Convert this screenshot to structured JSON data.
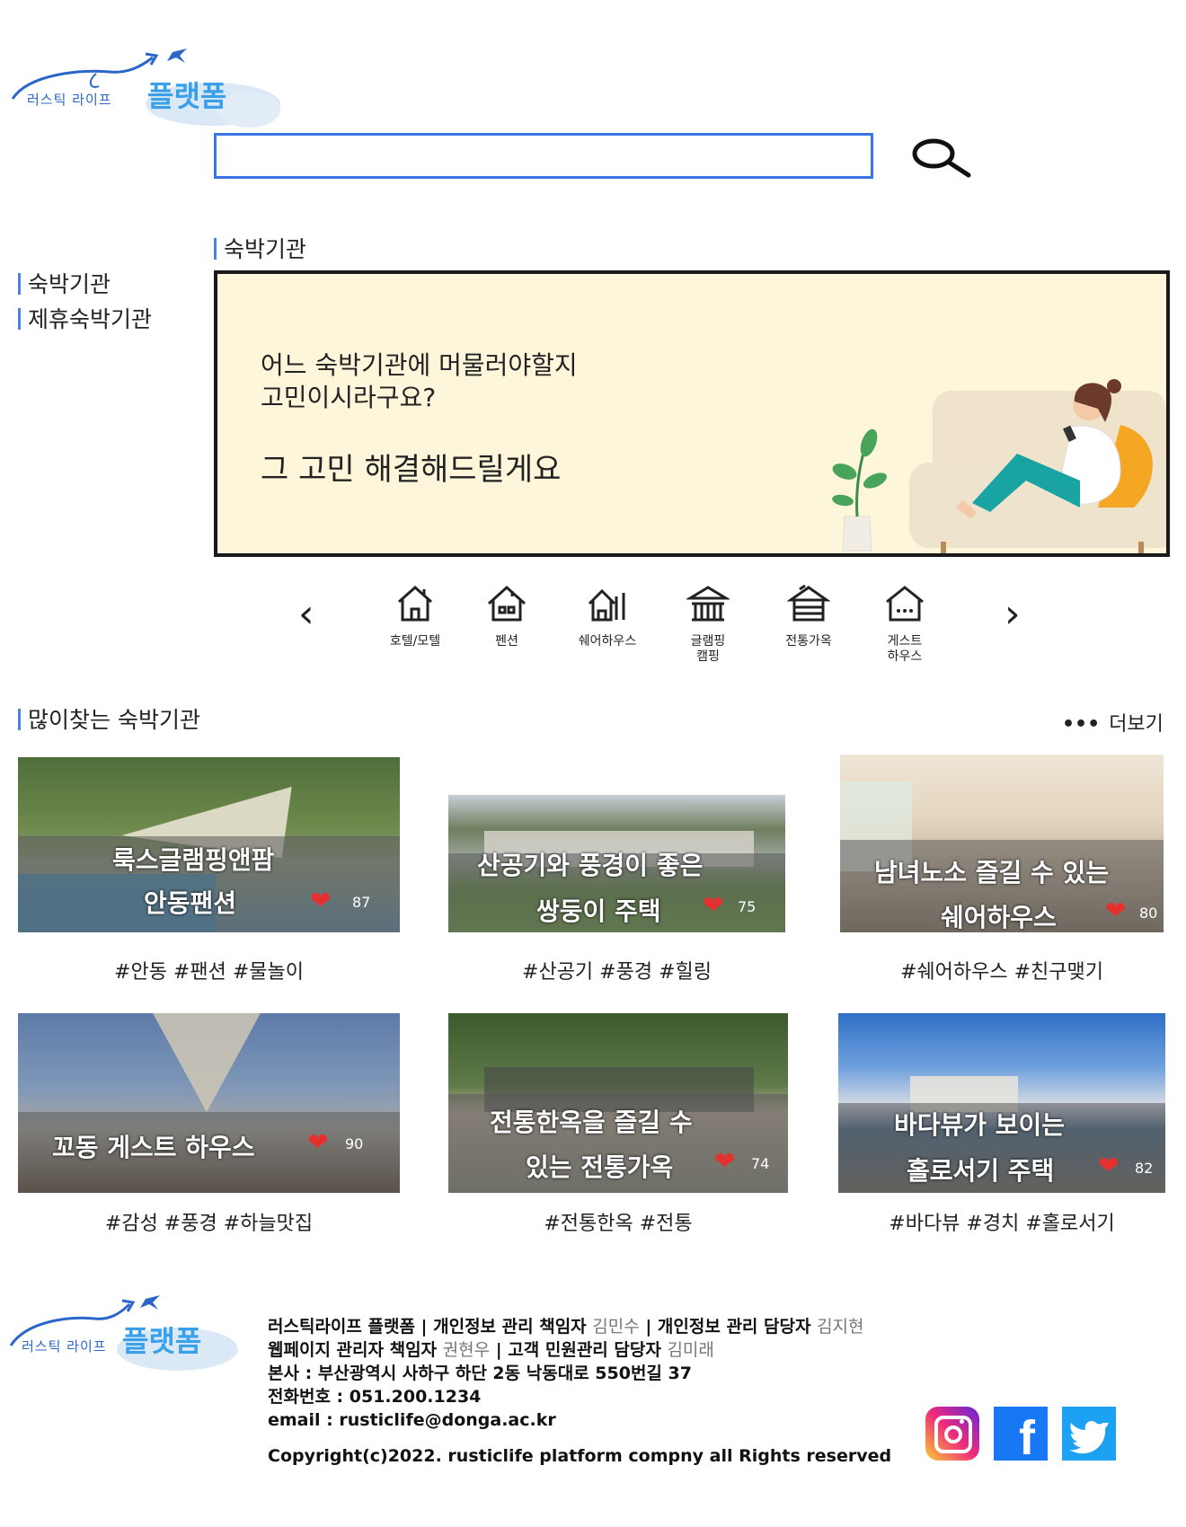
{
  "logo": {
    "small": "러스틱 라이프",
    "big": "플랫폼"
  },
  "search": {
    "placeholder": "",
    "value": ""
  },
  "sidebar": {
    "items": [
      {
        "label": "숙박기관"
      },
      {
        "label": "제휴숙박기관"
      }
    ]
  },
  "section_title": "숙박기관",
  "banner": {
    "line1": "어느 숙박기관에 머물러야할지",
    "line2": "고민이시라구요?",
    "line3": "그 고민 해결해드릴게요"
  },
  "categories": [
    {
      "label": "호텔/모텔",
      "icon": "house-hotel-icon"
    },
    {
      "label": "펜션",
      "icon": "house-pension-icon"
    },
    {
      "label": "쉐어하우스",
      "icon": "share-house-icon"
    },
    {
      "label": "글램핑\n캠핑",
      "icon": "glamping-icon"
    },
    {
      "label": "전통가옥",
      "icon": "traditional-house-icon"
    },
    {
      "label": "게스트\n하우스",
      "icon": "guest-house-icon"
    }
  ],
  "popular": {
    "title": "많이찾는 숙박기관",
    "more": "더보기",
    "cards": [
      {
        "name1": "룩스글램핑앤팜",
        "name2": "안동팬션",
        "likes": "87",
        "tags": "#안동 #팬션 #물놀이"
      },
      {
        "name1": "산공기와 풍경이 좋은",
        "name2": "쌍둥이 주택",
        "likes": "75",
        "tags": "#산공기 #풍경 #힐링"
      },
      {
        "name1": "남녀노소 즐길 수 있는",
        "name2": "쉐어하우스",
        "likes": "80",
        "tags": "#쉐어하우스 #친구맺기"
      },
      {
        "name1": "꼬동 게스트 하우스",
        "name2": "",
        "likes": "90",
        "tags": "#감성 #풍경 #하늘맛집"
      },
      {
        "name1": "전통한옥을 즐길 수",
        "name2": "있는 전통가옥",
        "likes": "74",
        "tags": "#전통한옥 #전통"
      },
      {
        "name1": "바다뷰가 보이는",
        "name2": "홀로서기 주택",
        "likes": "82",
        "tags": "#바다뷰 #경치 #홀로서기"
      }
    ]
  },
  "footer": {
    "l1a": "러스틱라이프 플랫폼 | 개인정보 관리 책임자 ",
    "l1b": "김민수",
    "l1c": " | 개인정보 관리 담당자 ",
    "l1d": "김지현",
    "l2a": "웹페이지 관리자 책임자 ",
    "l2b": "권현우",
    "l2c": " | 고객 민원관리 담당자 ",
    "l2d": "김미래",
    "l3": "본사 : 부산광역시 사하구 하단 2동 낙동대로 550번길 37",
    "l4": "전화번호 : 051.200.1234",
    "l5": "email : rusticlife@donga.ac.kr",
    "l6": "Copyright(c)2022. rusticlife platform compny all Rights reserved"
  },
  "colors": {
    "accent": "#4a82e0",
    "banner_bg": "#fdf6da",
    "heart": "#e63030",
    "logo_blue": "#3aa0ea"
  }
}
